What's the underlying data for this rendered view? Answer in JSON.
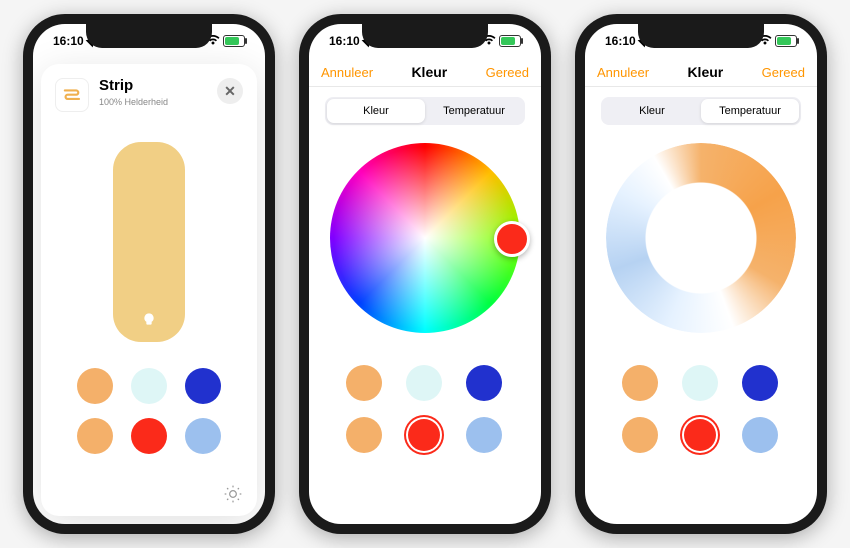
{
  "status": {
    "time": "16:10"
  },
  "colors": {
    "accent": "#ff9500",
    "swatches": [
      "#f4b06a",
      "#def6f6",
      "#2131ce",
      "#f4b06a",
      "#fb2a1a",
      "#9cc0ee"
    ],
    "brightnessFill": "#f1cf85"
  },
  "screen1": {
    "title": "Strip",
    "subtitle": "100% Helderheid"
  },
  "screen2": {
    "cancel": "Annuleer",
    "title": "Kleur",
    "done": "Gereed",
    "segment": {
      "color": "Kleur",
      "temperature": "Temperatuur",
      "active": "color"
    }
  },
  "screen3": {
    "cancel": "Annuleer",
    "title": "Kleur",
    "done": "Gereed",
    "segment": {
      "color": "Kleur",
      "temperature": "Temperatuur",
      "active": "temperature"
    }
  }
}
